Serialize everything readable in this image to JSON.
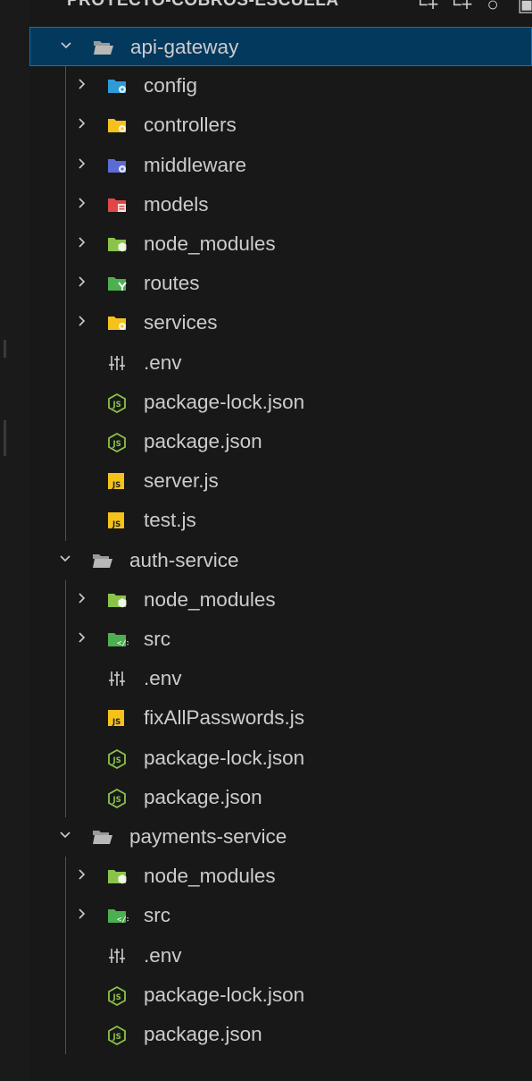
{
  "explorer": {
    "title": "PROYECTO-COBROS-ESCUELA",
    "actions": [
      {
        "name": "new-file-icon",
        "glyph": "└+"
      },
      {
        "name": "new-folder-icon",
        "glyph": "└+"
      },
      {
        "name": "refresh-icon",
        "glyph": "○"
      },
      {
        "name": "collapse-all-icon",
        "glyph": "▣"
      }
    ]
  },
  "tree": [
    {
      "label": "api-gateway",
      "kind": "folder-open",
      "depth": 0,
      "icon": "folder-open-icon",
      "selected": true
    },
    {
      "label": "config",
      "kind": "folder",
      "depth": 1,
      "icon": "folder-config-icon",
      "color": "#2f9bd6",
      "badge": "gear"
    },
    {
      "label": "controllers",
      "kind": "folder",
      "depth": 1,
      "icon": "folder-controllers-icon",
      "color": "#f5c21b",
      "badge": "gear"
    },
    {
      "label": "middleware",
      "kind": "folder",
      "depth": 1,
      "icon": "folder-middleware-icon",
      "color": "#5d6bd6",
      "badge": "gear"
    },
    {
      "label": "models",
      "kind": "folder",
      "depth": 1,
      "icon": "folder-models-icon",
      "color": "#e04848",
      "badge": "db"
    },
    {
      "label": "node_modules",
      "kind": "folder",
      "depth": 1,
      "icon": "folder-node-icon",
      "color": "#8bc34a",
      "badge": "hex"
    },
    {
      "label": "routes",
      "kind": "folder",
      "depth": 1,
      "icon": "folder-routes-icon",
      "color": "#4caf50",
      "badge": "route"
    },
    {
      "label": "services",
      "kind": "folder",
      "depth": 1,
      "icon": "folder-services-icon",
      "color": "#f5c21b",
      "badge": "gear"
    },
    {
      "label": ".env",
      "kind": "file",
      "depth": 1,
      "icon": "env-file-icon"
    },
    {
      "label": "package-lock.json",
      "kind": "file",
      "depth": 1,
      "icon": "nodejs-file-icon"
    },
    {
      "label": "package.json",
      "kind": "file",
      "depth": 1,
      "icon": "nodejs-file-icon"
    },
    {
      "label": "server.js",
      "kind": "file",
      "depth": 1,
      "icon": "js-file-icon"
    },
    {
      "label": "test.js",
      "kind": "file",
      "depth": 1,
      "icon": "js-file-icon"
    },
    {
      "label": "auth-service",
      "kind": "folder-open",
      "depth": 0,
      "icon": "folder-open-icon"
    },
    {
      "label": "node_modules",
      "kind": "folder",
      "depth": 1,
      "icon": "folder-node-icon",
      "color": "#8bc34a",
      "badge": "hex"
    },
    {
      "label": "src",
      "kind": "folder",
      "depth": 1,
      "icon": "folder-src-icon",
      "color": "#4caf50",
      "badge": "code"
    },
    {
      "label": ".env",
      "kind": "file",
      "depth": 1,
      "icon": "env-file-icon"
    },
    {
      "label": "fixAllPasswords.js",
      "kind": "file",
      "depth": 1,
      "icon": "js-file-icon"
    },
    {
      "label": "package-lock.json",
      "kind": "file",
      "depth": 1,
      "icon": "nodejs-file-icon"
    },
    {
      "label": "package.json",
      "kind": "file",
      "depth": 1,
      "icon": "nodejs-file-icon"
    },
    {
      "label": "payments-service",
      "kind": "folder-open",
      "depth": 0,
      "icon": "folder-open-icon"
    },
    {
      "label": "node_modules",
      "kind": "folder",
      "depth": 1,
      "icon": "folder-node-icon",
      "color": "#8bc34a",
      "badge": "hex"
    },
    {
      "label": "src",
      "kind": "folder",
      "depth": 1,
      "icon": "folder-src-icon",
      "color": "#4caf50",
      "badge": "code"
    },
    {
      "label": ".env",
      "kind": "file",
      "depth": 1,
      "icon": "env-file-icon"
    },
    {
      "label": "package-lock.json",
      "kind": "file",
      "depth": 1,
      "icon": "nodejs-file-icon"
    },
    {
      "label": "package.json",
      "kind": "file",
      "depth": 1,
      "icon": "nodejs-file-icon"
    }
  ],
  "colors": {
    "selection_bg": "#04395e",
    "selection_border": "#0a74c4",
    "text": "#cccccc",
    "js_yellow": "#f5c21b",
    "node_green": "#8bc34a"
  }
}
